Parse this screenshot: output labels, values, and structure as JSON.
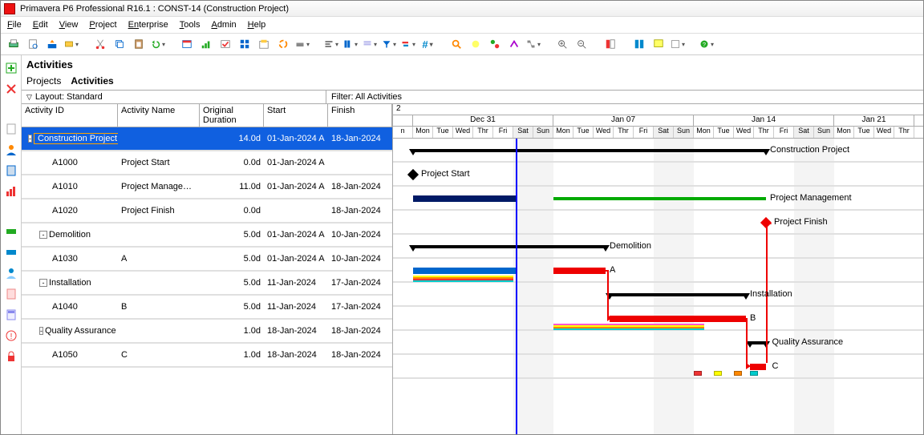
{
  "window": {
    "title": "Primavera P6 Professional R16.1 : CONST-14 (Construction Project)"
  },
  "menu": [
    "File",
    "Edit",
    "View",
    "Project",
    "Enterprise",
    "Tools",
    "Admin",
    "Help"
  ],
  "heading": "Activities",
  "tabs": {
    "projects": "Projects",
    "activities": "Activities"
  },
  "layout": {
    "label": "Layout: Standard",
    "filter": "Filter: All Activities"
  },
  "columns": {
    "id": "Activity ID",
    "name": "Activity Name",
    "dur": "Original Duration",
    "start": "Start",
    "finish": "Finish"
  },
  "timescale": {
    "weeks": [
      "Dec 31",
      "Jan 07",
      "Jan 14",
      "Jan 21"
    ],
    "days": [
      "n",
      "Mon",
      "Tue",
      "Wed",
      "Thr",
      "Fri",
      "Sat",
      "Sun",
      "Mon",
      "Tue",
      "Wed",
      "Thr",
      "Fri",
      "Sat",
      "Sun",
      "Mon",
      "Tue",
      "Wed",
      "Thr",
      "Fri",
      "Sat",
      "Sun",
      "Mon",
      "Tue",
      "Wed",
      "Thr"
    ]
  },
  "rows": [
    {
      "type": "project",
      "id": "Construction Project",
      "name": "",
      "dur": "14.0d",
      "start": "01-Jan-2024 A",
      "finish": "18-Jan-2024",
      "label": "Construction Project"
    },
    {
      "type": "activity",
      "indent": 2,
      "id": "A1000",
      "name": "Project Start",
      "dur": "0.0d",
      "start": "01-Jan-2024 A",
      "finish": "",
      "label": "Project Start"
    },
    {
      "type": "activity",
      "indent": 2,
      "id": "A1010",
      "name": "Project Management",
      "dur": "11.0d",
      "start": "01-Jan-2024 A",
      "finish": "18-Jan-2024",
      "label": "Project Management"
    },
    {
      "type": "activity",
      "indent": 2,
      "id": "A1020",
      "name": "Project Finish",
      "dur": "0.0d",
      "start": "",
      "finish": "18-Jan-2024",
      "label": "Project Finish"
    },
    {
      "type": "wbs",
      "indent": 1,
      "id": "Demolition",
      "name": "",
      "dur": "5.0d",
      "start": "01-Jan-2024 A",
      "finish": "10-Jan-2024",
      "label": "Demolition"
    },
    {
      "type": "activity",
      "indent": 2,
      "id": "A1030",
      "name": "A",
      "dur": "5.0d",
      "start": "01-Jan-2024 A",
      "finish": "10-Jan-2024",
      "label": "A"
    },
    {
      "type": "wbs",
      "indent": 1,
      "id": "Installation",
      "name": "",
      "dur": "5.0d",
      "start": "11-Jan-2024",
      "finish": "17-Jan-2024",
      "label": "Installation"
    },
    {
      "type": "activity",
      "indent": 2,
      "id": "A1040",
      "name": "B",
      "dur": "5.0d",
      "start": "11-Jan-2024",
      "finish": "17-Jan-2024",
      "label": "B"
    },
    {
      "type": "wbs",
      "indent": 1,
      "id": "Quality Assurance",
      "name": "",
      "dur": "1.0d",
      "start": "18-Jan-2024",
      "finish": "18-Jan-2024",
      "label": "Quality Assurance"
    },
    {
      "type": "activity",
      "indent": 2,
      "id": "A1050",
      "name": "C",
      "dur": "1.0d",
      "start": "18-Jan-2024",
      "finish": "18-Jan-2024",
      "label": "C"
    }
  ]
}
